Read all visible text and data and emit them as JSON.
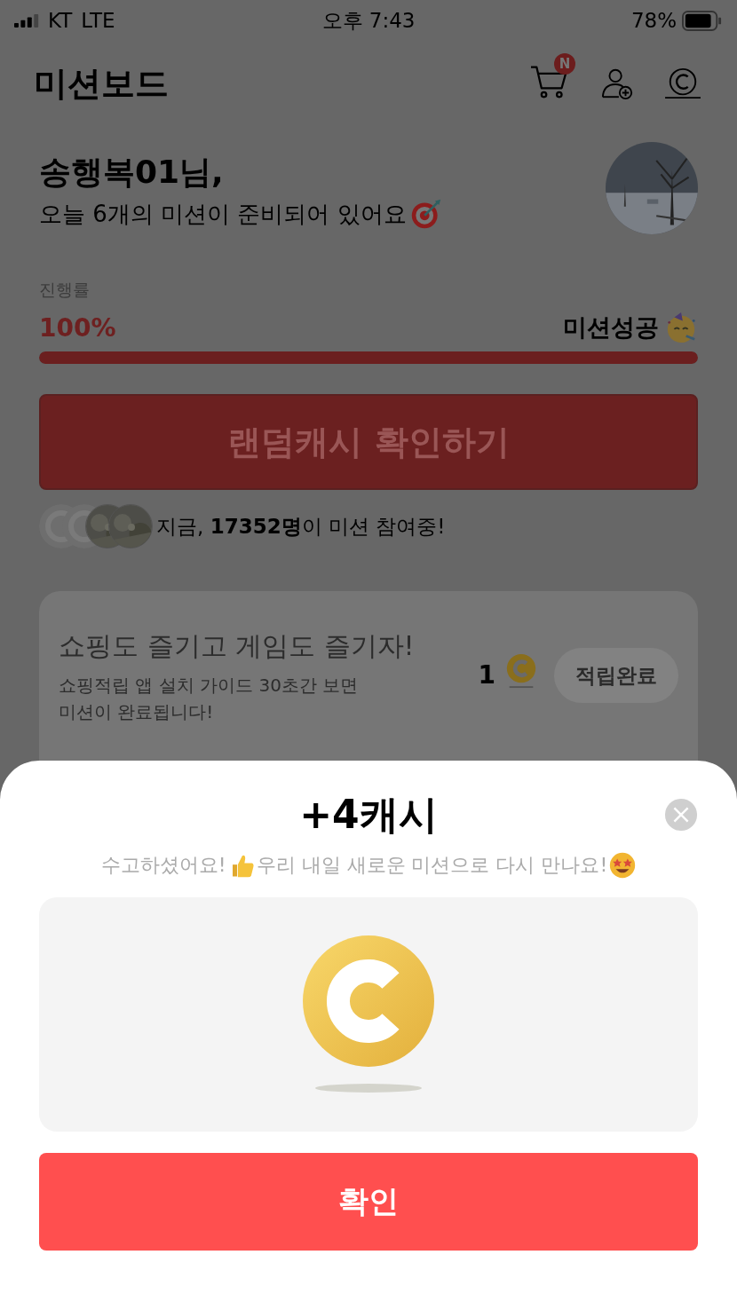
{
  "status_bar": {
    "carrier": "KT",
    "network": "LTE",
    "time": "오후 7:43",
    "battery": "78%"
  },
  "header": {
    "title": "미션보드",
    "cart_badge": "N"
  },
  "greeting": {
    "name": "송행복01님,",
    "message": "오늘 6개의 미션이 준비되어 있어요"
  },
  "progress": {
    "label": "진행률",
    "percent": "100%",
    "status": "미션성공",
    "level": 1
  },
  "random_cash_button": "랜덤캐시 확인하기",
  "participants": {
    "text": "지금, **17352명**이 미션 참여중!"
  },
  "mission": {
    "title": "쇼핑도 즐기고 게임도 즐기자!",
    "description": "쇼핑적립 앱 설치 가이드 30초간 보면 미션이 완료됩니다!",
    "reward": "1",
    "button": "적립완료",
    "completed": true
  },
  "popup": {
    "title": "+4캐시",
    "message": [
      "수고하셨어요!",
      "우리 내일 새로운 미션으로 다시 만나요!"
    ],
    "confirm_button": "확인"
  }
}
